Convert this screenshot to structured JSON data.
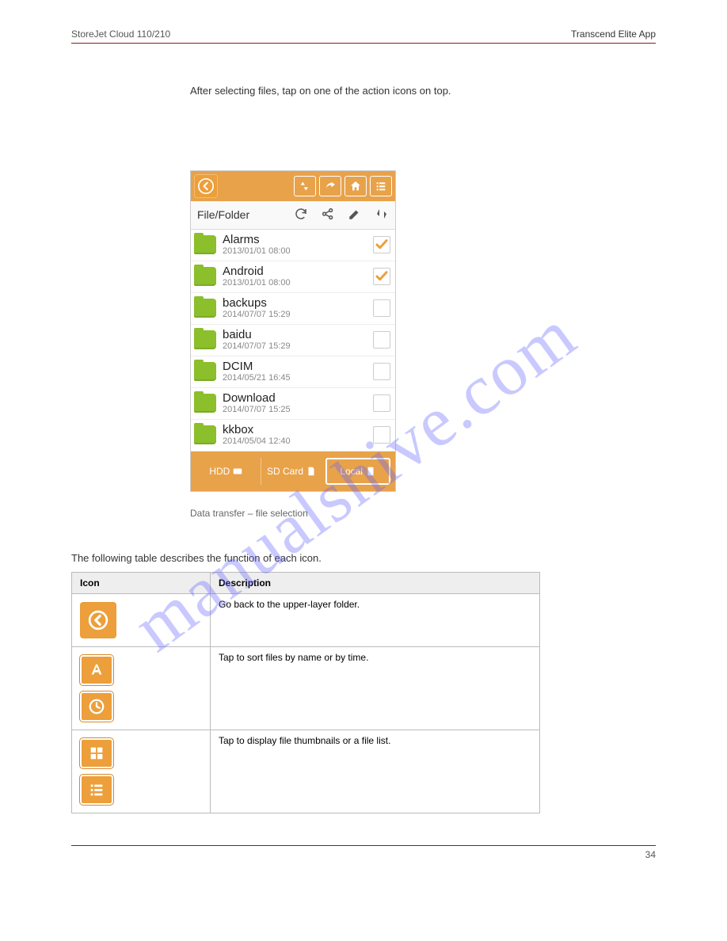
{
  "header": {
    "doc_title": "StoreJet Cloud 110/210",
    "section": "Transcend Elite App"
  },
  "footer": {
    "page": "34"
  },
  "watermark": "manualshive.com",
  "intro": "After selecting files, tap on one of the action icons on top.",
  "phone": {
    "sub_label": "File/Folder",
    "rows": [
      {
        "name": "Alarms",
        "date": "2013/01/01 08:00",
        "checked": true
      },
      {
        "name": "Android",
        "date": "2013/01/01 08:00",
        "checked": true
      },
      {
        "name": "backups",
        "date": "2014/07/07 15:29",
        "checked": false
      },
      {
        "name": "baidu",
        "date": "2014/07/07 15:29",
        "checked": false
      },
      {
        "name": "DCIM",
        "date": "2014/05/21 16:45",
        "checked": false
      },
      {
        "name": "Download",
        "date": "2014/07/07 15:25",
        "checked": false
      },
      {
        "name": "kkbox",
        "date": "2014/05/04 12:40",
        "checked": false
      }
    ],
    "tabs": {
      "hdd": "HDD",
      "sd": "SD Card",
      "local": "Local"
    },
    "caption": "Data transfer – file selection"
  },
  "uitable_intro": "The following table describes the function of each icon.",
  "table": {
    "head": {
      "icon": "Icon",
      "desc": "Description"
    },
    "rows": [
      {
        "desc": "Go back to the upper-layer folder."
      },
      {
        "desc_line1": "Tap to sort files by name or by time.",
        "desc_line2": " / ",
        "desc_note": ""
      },
      {
        "desc_line1": "Tap to display file thumbnails or a file list.",
        "desc_line2": " / "
      }
    ]
  }
}
